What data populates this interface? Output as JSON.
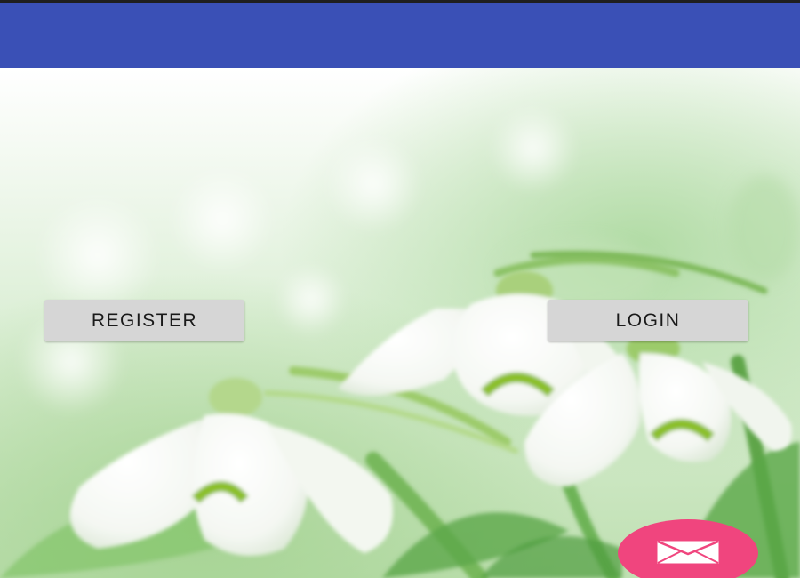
{
  "app_bar": {
    "color": "#3a50b6"
  },
  "actions": {
    "register_label": "REGISTER",
    "login_label": "LOGIN"
  },
  "fab": {
    "icon": "mail-icon",
    "color": "#f0457e"
  },
  "background": {
    "description_icon": "snowdrop-flowers-image"
  }
}
